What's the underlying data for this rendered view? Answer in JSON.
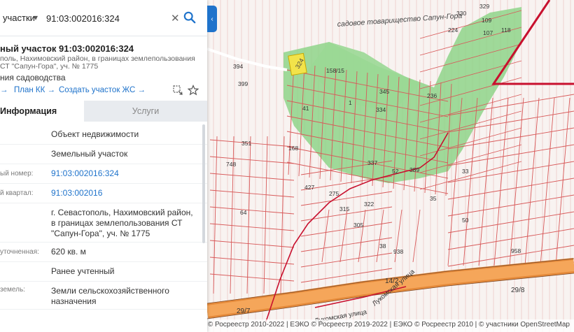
{
  "search": {
    "type_label": "участки",
    "value": "91:03:002016:324"
  },
  "card": {
    "title": "ный участок 91:03:002016:324",
    "address": "поль, Нахимовский район, в границах землепользования СТ \"Сапун-Гора\", уч. № 1775",
    "usage": "ния садоводства"
  },
  "actions": {
    "first": "→",
    "plan_kk": "План КК →",
    "create_zhs": "Создать участок ЖС →"
  },
  "tabs": {
    "info": "Информация",
    "services": "Услуги"
  },
  "info_rows": [
    {
      "label": "",
      "value": "Объект недвижимости",
      "link": false
    },
    {
      "label": "",
      "value": "Земельный участок",
      "link": false
    },
    {
      "label": "ый номер:",
      "value": "91:03:002016:324",
      "link": true
    },
    {
      "label": "й квартал:",
      "value": "91:03:002016",
      "link": true
    },
    {
      "label": "",
      "value": "г. Севастополь, Нахимовский район, в границах землепользования СТ \"Сапун-Гора\", уч. № 1775",
      "link": false
    },
    {
      "label": "уточненная:",
      "value": "620 кв. м",
      "link": false
    },
    {
      "label": "",
      "value": "Ранее учтенный",
      "link": false
    },
    {
      "label": "земель:",
      "value": "Земли сельскохозяйственного назначения",
      "link": false
    }
  ],
  "map": {
    "settlement_label": "садовое товарищество Сапун-Гора",
    "road_label_1": "14/2",
    "road_label_2": "Лукомская улица",
    "road_label_3": "Лукомская улица",
    "road_label_4": "29/8",
    "road_label_5": "29/7",
    "parcel_selected": "324",
    "parcel_labels": [
      "330",
      "329",
      "109",
      "118",
      "107",
      "224",
      "158/15",
      "394",
      "399",
      "345",
      "334",
      "389",
      "52",
      "315",
      "748",
      "64",
      "275",
      "427",
      "41",
      "38",
      "938",
      "958",
      "168",
      "33",
      "351",
      "305",
      "35",
      "50",
      "337",
      "322",
      "236",
      "1"
    ],
    "attribution": "ПКК © Росреестр 2010-2022 | ЕЭКО © Росреестр 2019-2022 | ЕЭКО © Росреестр 2010 | © участники OpenStreetMap"
  },
  "colors": {
    "accent": "#1f73cb",
    "parcel_green": "#7dd27a",
    "parcel_line": "#e05050",
    "road_orange": "#f39a4a",
    "boundary_red": "#c8102e",
    "selected_yellow": "#f2e34a"
  }
}
